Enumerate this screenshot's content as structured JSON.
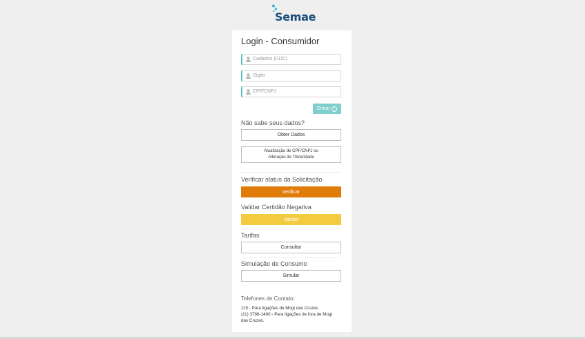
{
  "brand": {
    "name": "Semae",
    "color": "#1b4e7a",
    "accent": "#39b6d6"
  },
  "login": {
    "title": "Login - Consumidor",
    "fields": [
      {
        "placeholder": "Cadastro (CDC)",
        "icon": "user-icon"
      },
      {
        "placeholder": "Digito",
        "icon": "user-icon"
      },
      {
        "placeholder": "CPF/CNPJ",
        "icon": "user-icon"
      }
    ],
    "enter_label": "Entrar",
    "enter_icon": "arrow-circle-icon"
  },
  "sections": {
    "forgot_label": "Não sabe seus dados?",
    "get_data_button": "Obter Dados",
    "update_button_line1": "Atualização de CPF/CNPJ ou",
    "update_button_line2": "Alteração de Titularidade",
    "status_label": "Verificar status da Solicitação",
    "status_button": "Verificar",
    "certidao_label": "Validar Certidão Negativa",
    "certidao_button": "Validar",
    "tarifas_label": "Tarifas",
    "tarifas_button": "Consultar",
    "simulacao_label": "Simulação de Consumo",
    "simulacao_button": "Simular"
  },
  "contacts": {
    "title": "Telefones de Contato:",
    "line1": "115 - Para ligações de Mogi das Cruzes",
    "line2": "(11) 3786-1400 - Para ligações de fora de Mogi",
    "line3": "das Cruzes."
  },
  "colors": {
    "teal": "#7fcfcc",
    "orange": "#e07c0a",
    "yellow": "#f2cc3e"
  }
}
